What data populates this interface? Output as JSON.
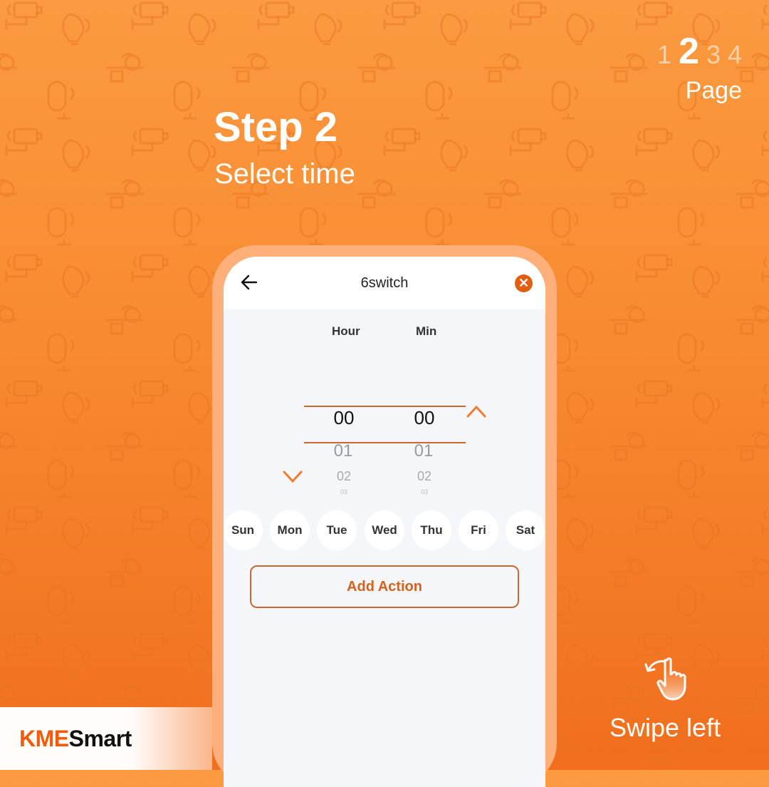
{
  "pager": {
    "pages": [
      "1",
      "2",
      "3",
      "4"
    ],
    "current": "2",
    "label": "Page"
  },
  "step": {
    "title": "Step 2",
    "subtitle": "Select time"
  },
  "app": {
    "title": "6switch",
    "back_icon": "arrow-left-icon",
    "close_icon": "close-circle-icon",
    "picker": {
      "columns": [
        {
          "header": "Hour",
          "selected": "00",
          "next": [
            "01",
            "02",
            "03"
          ]
        },
        {
          "header": "Min",
          "selected": "00",
          "next": [
            "01",
            "02",
            "03"
          ]
        }
      ]
    },
    "days": [
      "Sun",
      "Mon",
      "Tue",
      "Wed",
      "Thu",
      "Fri",
      "Sat"
    ],
    "add_action_label": "Add Action"
  },
  "brand": {
    "part1": "KME",
    "part2": "Smart"
  },
  "hint": {
    "label": "Swipe left",
    "icon": "swipe-left-hand-icon"
  },
  "colors": {
    "accent": "#f45a0c",
    "primary_bg": "#f88a31",
    "button_text": "#d4611e",
    "close_bg": "#e35d12"
  }
}
